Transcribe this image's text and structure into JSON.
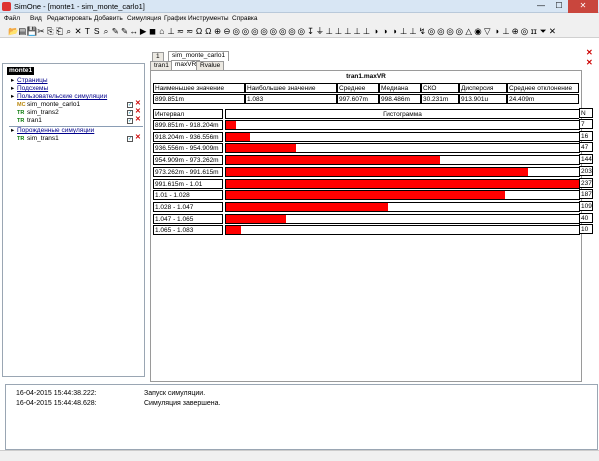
{
  "window": {
    "title": "SimOne - [monte1 - sim_monte_carlo1]",
    "min_glyph": "—",
    "max_glyph": "☐",
    "close_glyph": "✕"
  },
  "menu": [
    "Файл",
    "Вид",
    "Редактировать",
    "Добавить",
    "Симуляция",
    "График",
    "Инструменты",
    "Справка"
  ],
  "toolbar": {
    "glyphs": [
      "📂",
      "▤",
      "💾",
      "✂",
      "⎘",
      "⎗",
      "⌕",
      "✕",
      "T",
      "S",
      "⌕",
      "✎",
      "✎",
      "↔",
      "▶",
      "◼",
      "⌂",
      "⊥",
      "≂",
      "≂",
      "Ω",
      "Ω",
      "⊕",
      "⊖",
      "◎",
      "◎",
      "◎",
      "◎",
      "◎",
      "◎",
      "◎",
      "◎",
      "↧",
      "⏚",
      "⊥",
      "⊥",
      "⊥",
      "⊥",
      "⊥",
      "◑",
      "◑",
      "◑",
      "⊥",
      "⊥",
      "↯",
      "◎",
      "◎",
      "◎",
      "◎",
      "△",
      "◉",
      "▽",
      "◑",
      "⊥",
      "⊕",
      "◎",
      "ɪɪ",
      "⏷",
      "✕"
    ]
  },
  "tabs": {
    "outer": [
      "1",
      "sim_monte_carlo1"
    ],
    "inner": [
      "tran1",
      "maxVR",
      "Rvalue"
    ],
    "active_inner": "maxVR",
    "close_glyph": "✕"
  },
  "tree": {
    "root": "monte1",
    "sections": {
      "pages": "Страницы",
      "subcircuits": "Подсхемы",
      "user_sims": "Пользовательские симуляции",
      "derived_sims": "Порожденные симуляции"
    },
    "items": [
      {
        "icon": "MC",
        "label": "sim_monte_carlo1"
      },
      {
        "icon": "TR",
        "label": "sim_trans2"
      },
      {
        "icon": "TR",
        "label": "tran1"
      }
    ],
    "derived_items": [
      {
        "icon": "TR",
        "label": "sim_trans1"
      }
    ],
    "check_glyph": "✓",
    "delete_glyph": "✕",
    "expand_glyph": "▸"
  },
  "stats": {
    "title": "tran1.maxVR",
    "headers": [
      "Наименьшее значение",
      "Наибольшее значение",
      "Среднее",
      "Медиана",
      "СКО",
      "Дисперсия",
      "Среднее отклонение"
    ],
    "values": [
      "899.851m",
      "1.083",
      "997.607m",
      "998.486m",
      "30.231m",
      "913.901u",
      "24.409m"
    ]
  },
  "histogram": {
    "headers": [
      "Интервал",
      "Гистограмма",
      "N"
    ],
    "max_count": 237
  },
  "chart_data": {
    "type": "bar",
    "title": "tran1.maxVR",
    "categories": [
      "899.851m - 918.204m",
      "918.204m - 936.556m",
      "936.556m - 954.909m",
      "954.909m - 973.262m",
      "973.262m - 991.615m",
      "991.615m - 1.01",
      "1.01 - 1.028",
      "1.028 - 1.047",
      "1.047 - 1.065",
      "1.065 - 1.083"
    ],
    "values": [
      7,
      16,
      47,
      144,
      203,
      237,
      187,
      109,
      40,
      10
    ],
    "xlabel": "Интервал",
    "ylabel": "N",
    "ylim": [
      0,
      237
    ],
    "colors": {
      "bar": "#ff0000"
    }
  },
  "log": [
    {
      "time": "16-04-2015 15:44:38.222:",
      "message": "Запуск симуляции."
    },
    {
      "time": "16-04-2015 15:44:48.628:",
      "message": "Симуляция завершена."
    }
  ],
  "colors": {
    "accent_bar": "#ff0000",
    "title_bar": "#d8e6f4",
    "close_button": "#c9463d"
  }
}
